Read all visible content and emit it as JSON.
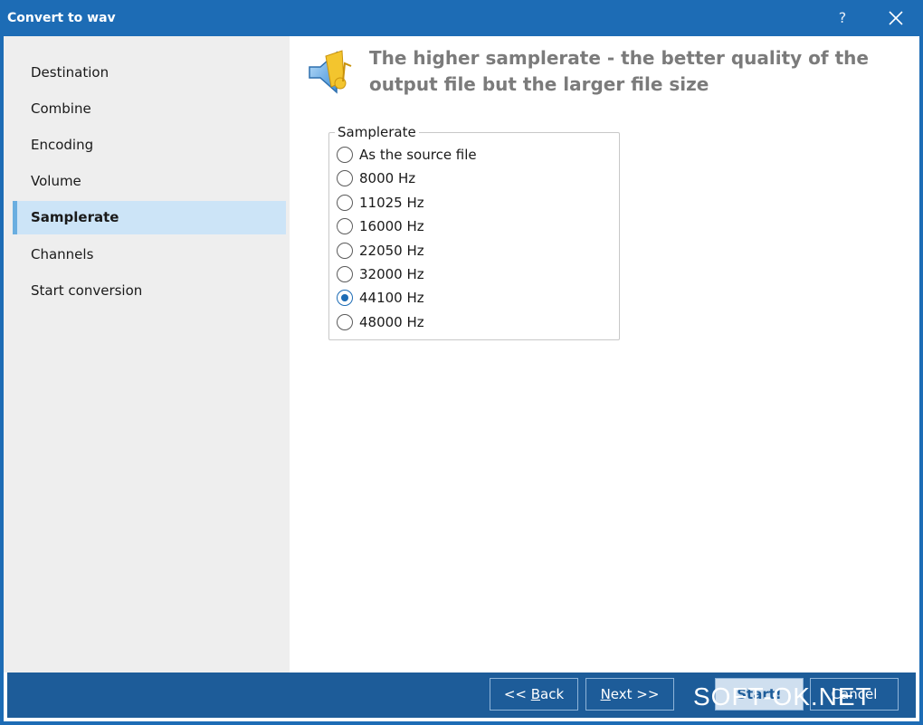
{
  "window": {
    "title": "Convert to wav",
    "help_label": "?"
  },
  "sidebar": {
    "items": [
      {
        "label": "Destination",
        "active": false
      },
      {
        "label": "Combine",
        "active": false
      },
      {
        "label": "Encoding",
        "active": false
      },
      {
        "label": "Volume",
        "active": false
      },
      {
        "label": "Samplerate",
        "active": true
      },
      {
        "label": "Channels",
        "active": false
      },
      {
        "label": "Start conversion",
        "active": false
      }
    ]
  },
  "header": {
    "text": "The higher samplerate - the better quality of the output file but the larger file size",
    "icon": "speaker-icon"
  },
  "samplerate": {
    "group_label": "Samplerate",
    "selected": "44100 Hz",
    "options": [
      "As the source file",
      "8000 Hz",
      "11025 Hz",
      "16000 Hz",
      "22050 Hz",
      "32000 Hz",
      "44100 Hz",
      "48000 Hz"
    ]
  },
  "footer": {
    "back_prefix": "<< ",
    "back_accel": "B",
    "back_rest": "ack",
    "next_accel": "N",
    "next_rest": "ext >>",
    "start_label": "Start!",
    "cancel_label": "Cancel"
  },
  "watermark": "SOFT-OK.NET",
  "colors": {
    "accent": "#1d6cb5",
    "footer": "#1d5c99",
    "sidebar_bg": "#eeeeee",
    "selected_item": "#cce4f7"
  }
}
